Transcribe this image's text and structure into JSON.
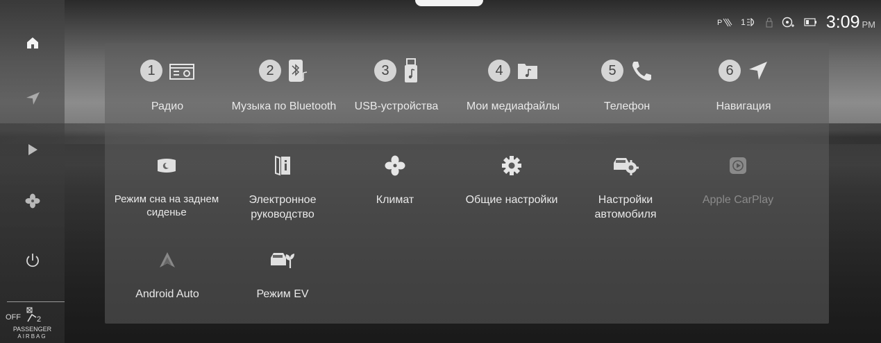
{
  "status_bar": {
    "indicator_text": "1",
    "time": "3:09",
    "ampm": "PM"
  },
  "sidebar": {
    "items": [
      {
        "name": "home-icon"
      },
      {
        "name": "navigation-arrow-icon"
      },
      {
        "name": "play-icon"
      },
      {
        "name": "fan-icon"
      },
      {
        "name": "power-icon"
      }
    ],
    "airbag": {
      "off": "OFF",
      "seat_number": "2",
      "label_line1": "PASSENGER",
      "label_line2": "AIRBAG"
    }
  },
  "apps": [
    {
      "number": "1",
      "label": "Радио",
      "icon": "radio-icon"
    },
    {
      "number": "2",
      "label": "Музыка по Bluetooth",
      "icon": "bluetooth-music-icon"
    },
    {
      "number": "3",
      "label": "USB-устройства",
      "icon": "usb-music-icon"
    },
    {
      "number": "4",
      "label": "Мои медиафайлы",
      "icon": "media-folder-icon"
    },
    {
      "number": "5",
      "label": "Телефон",
      "icon": "phone-icon"
    },
    {
      "number": "6",
      "label": "Навигация",
      "icon": "navigation-icon"
    },
    {
      "label": "Режим сна на заднем сиденье",
      "icon": "rear-sleep-mode-icon"
    },
    {
      "label": "Электронное руководство",
      "icon": "e-manual-icon"
    },
    {
      "label": "Климат",
      "icon": "climate-fan-icon"
    },
    {
      "label": "Общие настройки",
      "icon": "settings-gear-icon"
    },
    {
      "label": "Настройки автомобиля",
      "icon": "vehicle-settings-icon"
    },
    {
      "label": "Apple CarPlay",
      "icon": "apple-carplay-icon",
      "enabled": false
    },
    {
      "label": "Android Auto",
      "icon": "android-auto-icon",
      "enabled": false
    },
    {
      "label": "Режим EV",
      "icon": "ev-mode-icon"
    }
  ]
}
